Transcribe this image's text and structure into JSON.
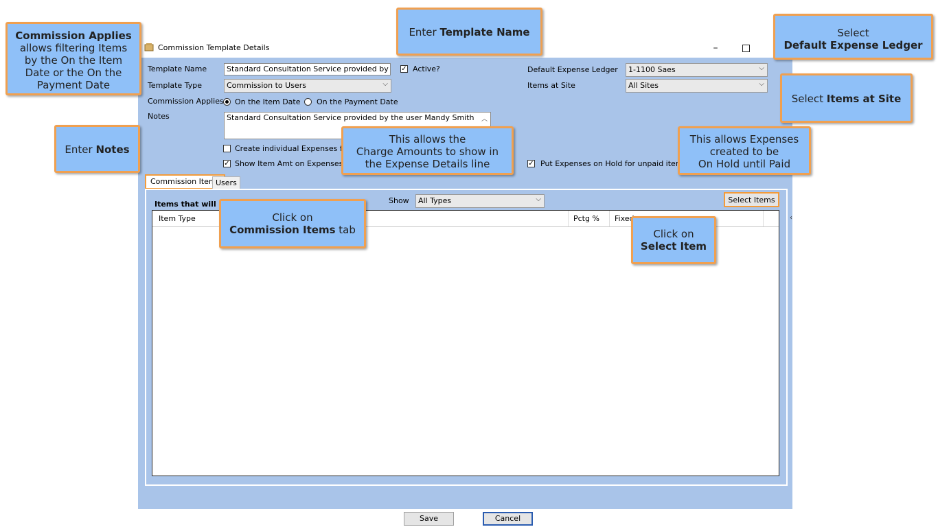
{
  "window": {
    "title": "Commission Template Details",
    "minimize_glyph": "–",
    "maximize_glyph": "☐"
  },
  "form": {
    "template_name_label": "Template Name",
    "template_name_value": "Standard Consultation Service provided by the use",
    "active_label": "Active?",
    "active_checked": true,
    "template_type_label": "Template Type",
    "template_type_value": "Commission to Users",
    "commission_applies_label": "Commission Applies",
    "radio_item_date": "On the Item Date",
    "radio_payment_date": "On the Payment Date",
    "notes_label": "Notes",
    "notes_value": "Standard Consultation Service provided by the user Mandy Smith",
    "create_expenses_label": "Create individual Expenses for co",
    "show_item_amt_label": "Show Item Amt on Expenses",
    "default_ledger_label": "Default Expense Ledger",
    "default_ledger_value": "1-1100 Saes",
    "items_at_site_label": "Items at Site",
    "items_at_site_value": "All Sites",
    "put_on_hold_label": "Put Expenses on Hold for unpaid items"
  },
  "tabs": [
    {
      "label": "Commission Items"
    },
    {
      "label": "Users"
    }
  ],
  "panel": {
    "heading": "Items that will ha",
    "show_label": "Show",
    "show_value": "All Types",
    "select_items_button": "Select Items",
    "columns": [
      "Item Type",
      "Pctg %",
      "Fixed"
    ]
  },
  "buttons": {
    "save": "Save",
    "cancel": "Cancel"
  },
  "callouts": {
    "commission_applies": {
      "bold": "Commission Applies",
      "lines": [
        "allows filtering Items",
        "by the On the Item",
        "Date or the On the",
        "Payment Date"
      ]
    },
    "template_name": {
      "pre": "Enter ",
      "bold": "Template Name"
    },
    "ledger": {
      "line1": "Select",
      "bold": "Default Expense Ledger"
    },
    "items_at_site": {
      "pre": "Select ",
      "bold": "Items at Site"
    },
    "notes": {
      "pre": "Enter ",
      "bold": "Notes"
    },
    "charge_amounts": {
      "lines": [
        "This allows the",
        "Charge Amounts to show in",
        "the Expense Details line"
      ]
    },
    "on_hold": {
      "lines": [
        "This allows Expenses",
        "created to be",
        "On Hold until Paid"
      ]
    },
    "commission_tab": {
      "line1": "Click on",
      "bold": "Commission Items",
      "post": " tab"
    },
    "select_item": {
      "line1": "Click on",
      "bold": "Select Item"
    }
  },
  "colors": {
    "client_bg": "#a9c4e9",
    "callout_bg": "#8fc0f8",
    "callout_border": "#f0a050"
  }
}
